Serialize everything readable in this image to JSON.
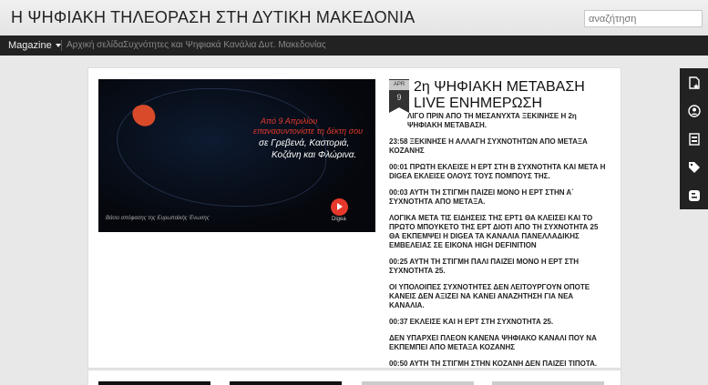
{
  "header": {
    "site_title": "Η ΨΗΦΙΑΚΗ ΤΗΛΕΟΡΑΣΗ ΣΤΗ ΔΥΤΙΚΗ ΜΑΚΕΔΟΝΙΑ",
    "search_placeholder": "αναζήτηση"
  },
  "nav": {
    "dropdown_label": "Magazine",
    "links": [
      "Αρχική σελίδα",
      "Συχνότητες και Ψηφιακά Κανάλια Δυτ. Μακεδονίας"
    ]
  },
  "post": {
    "image": {
      "line1": "Από 9 Απριλίου",
      "line2": "επανασυντονίστε τη δέκτη σου",
      "line3": "σε Γρεβενά, Καστοριά,",
      "line4": "Κοζάνη και Φλώρινα.",
      "caption": "Βάσει απόφασης της Ευρωπαϊκής Ένωσης",
      "logo": "Digea"
    },
    "date": {
      "month": "APR",
      "day": "9"
    },
    "title": "2η ΨΗΦΙΑΚΗ ΜΕΤΑΒΑΣΗ LIVE ΕΝΗΜΕΡΩΣΗ",
    "body": [
      "ΛΙΓΟ ΠΡΙΝ ΑΠΟ ΤΗ ΜΕΣΑΝΥΧΤΑ ΞΕΚΙΝΗΣΕ Η  2η ΨΗΦΙΑΚΗ ΜΕΤΑΒΑΣΗ.",
      "23:58 ΞΕΚΙΝΗΣΕ Η ΑΛΛΑΓΗ ΣΥΧΝΟΤΗΤΩΝ ΑΠΟ ΜΕΤΑΞΑ ΚΟΖΑΝΗΣ",
      "00:01 ΠΡΩΤΗ ΕΚΛΕΙΣΕ Η ΕΡΤ ΣΤΗ Β ΣΥΧΝΟΤΗΤΑ ΚΑΙ ΜΕΤΑ Η DIGEA ΕΚΛΕΙΣΕ  ΟΛΟΥΣ ΤΟΥΣ ΠΟΜΠΟΥΣ ΤΗΣ.",
      "00:03 ΑΥΤΗ ΤΗ ΣΤΙΓΜΗ ΠΑΙΖΕΙ ΜΟΝΟ Η ΕΡΤ ΣΤΗΝ Α΄ ΣΥΧΝΟΤΗΤΑ ΑΠΟ ΜΕΤΑΞΑ.",
      "ΛΟΓΙΚΑ ΜΕΤΑ ΤΙΣ ΕΙΔΗΣΕΙΣ ΤΗΣ ΕΡΤ1 ΘΑ ΚΛΕΙΣΕΙ ΚΑΙ ΤΟ ΠΡΩΤΟ ΜΠΟΥΚΕΤΟ ΤΗΣ ΕΡΤ ΔΙΟΤΙ ΑΠΟ ΤΗ ΣΥΧΝΟΤΗΤΑ 25 ΘΑ ΕΚΠΕΜΨΕΙ Η DIGEA ΤΑ ΚΑΝΑΛΙΑ ΠΑΝΕΛΛΑΔΙΚΗΣ ΕΜΒΕΛΕΙΑΣ ΣΕ ΕΙΚΟΝΑ HIGH DEFINITION",
      "00:25 ΑΥΤΗ ΤΗ ΣΤΙΓΜΗ ΠΑΛΙ ΠΑΙΖΕΙ ΜΟΝΟ Η ΕΡΤ ΣΤΗ ΣΥΧΝΟΤΗΤΑ 25.",
      "ΟΙ ΥΠΟΛΟΙΠΕΣ ΣΥΧΝΟΤΗΤΕΣ ΔΕΝ ΛΕΙΤΟΥΡΓΟΥΝ ΟΠΟΤΕ ΚΑΝΕΙΣ ΔΕΝ ΑΞΙΖΕΙ ΝΑ ΚΑΝΕΙ ΑΝΑΖΗΤΗΣΗ ΓΙΑ ΝΕΑ ΚΑΝΑΛΙΑ.",
      "00:37 ΕΚΛΕΙΣΕ ΚΑΙ Η ΕΡΤ ΣΤΗ ΣΥΧΝΟΤΗΤΑ 25.",
      "ΔΕΝ ΥΠΑΡΧΕΙ ΠΛΕΟΝ ΚΑΝΕΝΑ ΨΗΦΙΑΚΟ ΚΑΝΑΛΙ ΠΟΥ ΝΑ ΕΚΠΕΜΠΕΙ ΑΠΟ ΜΕΤΑΞΑ ΚΟΖΑΝΗΣ",
      "00:50 ΑΥΤΗ ΤΗ ΣΤΙΓΜΗ ΣΤΗΝ ΚΟΖΑΝΗ ΔΕΝ ΠΑΙΖΕΙ ΤΙΠΟΤΑ."
    ]
  },
  "sidebar_icons": [
    "recent-posts-icon",
    "profile-icon",
    "archive-icon",
    "labels-icon",
    "blogger-icon"
  ],
  "colors": {
    "header_bg": "#eaeaea",
    "nav_bg": "#222222",
    "accent_red": "#e6392b",
    "sidebar_bg": "#222222"
  }
}
